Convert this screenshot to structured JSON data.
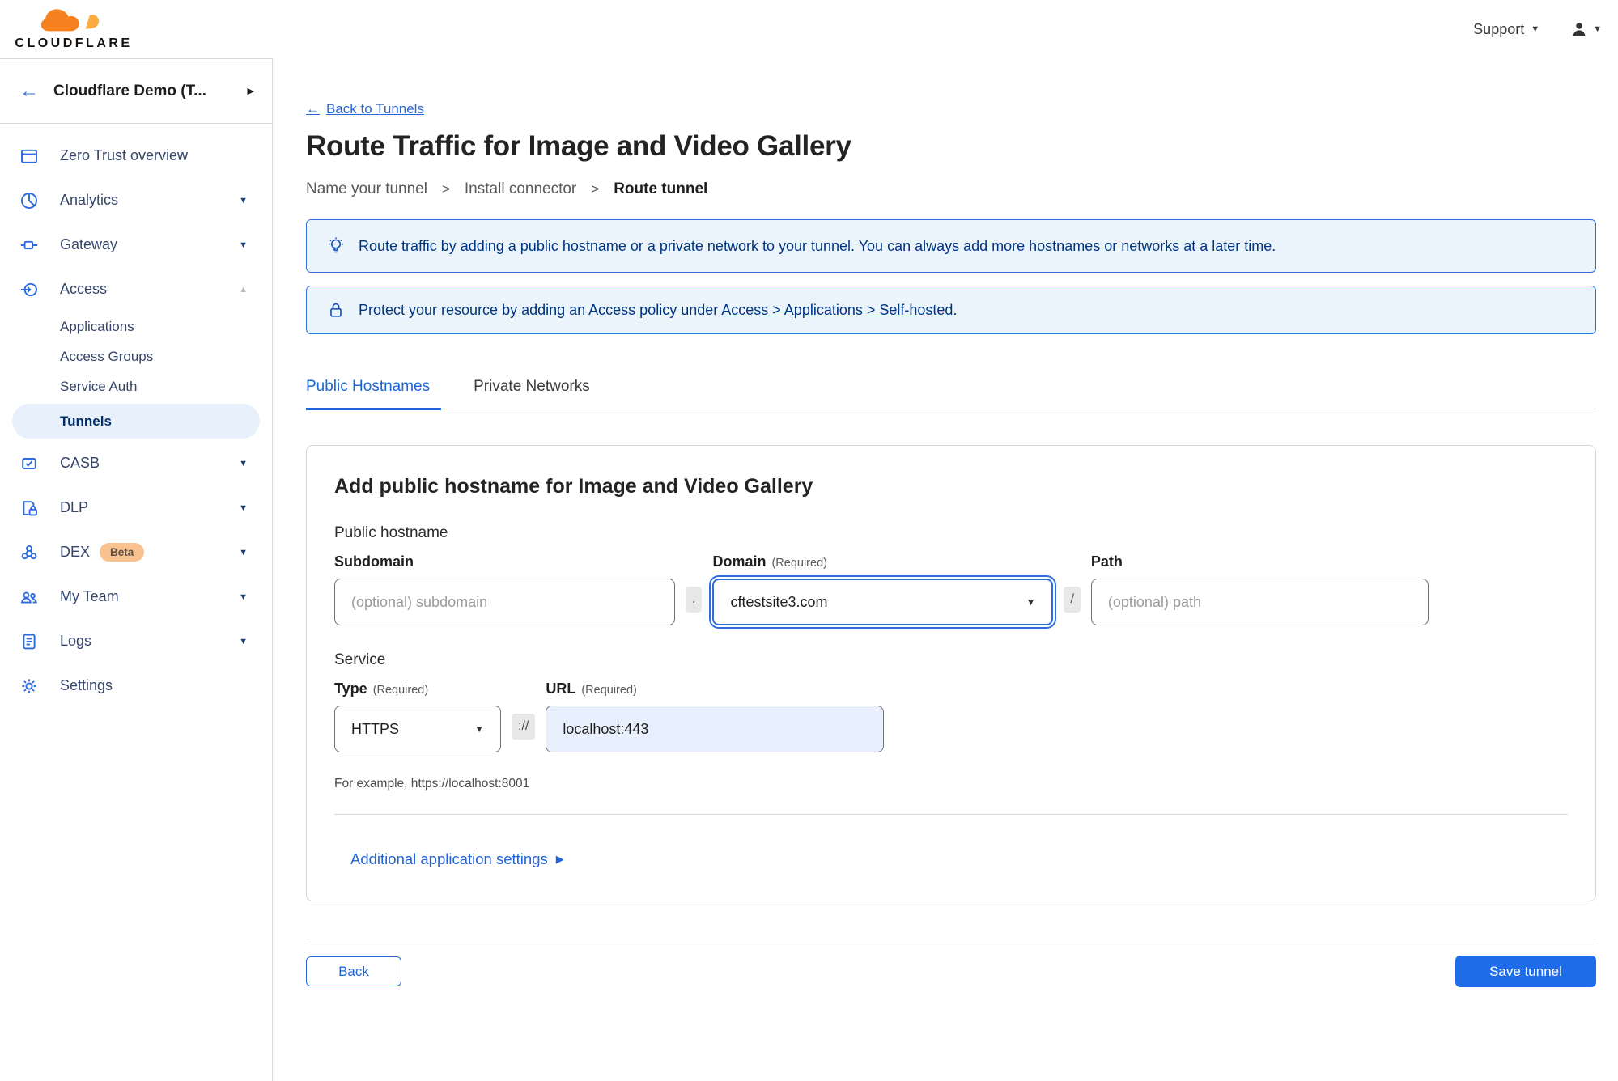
{
  "glyphs": {
    "back_arrow": "←",
    "expand_right": "▶",
    "chevron_down": "▼",
    "chevron_up": "▲",
    "caret_down": "▼",
    "breadcrumb_sep": ">",
    "disclosure_right": "▶"
  },
  "header": {
    "logo_word": "CLOUDFLARE",
    "support_label": "Support"
  },
  "sidebar": {
    "account_name": "Cloudflare Demo (T...",
    "items": [
      {
        "label": "Zero Trust overview",
        "chevron": false
      },
      {
        "label": "Analytics",
        "chevron": true
      },
      {
        "label": "Gateway",
        "chevron": true
      },
      {
        "label": "Access",
        "chevron": true
      },
      {
        "label": "CASB",
        "chevron": true
      },
      {
        "label": "DLP",
        "chevron": true
      },
      {
        "label": "DEX",
        "chevron": true,
        "badge": "Beta"
      },
      {
        "label": "My Team",
        "chevron": true
      },
      {
        "label": "Logs",
        "chevron": true
      },
      {
        "label": "Settings",
        "chevron": false
      }
    ],
    "access_children": [
      {
        "label": "Applications",
        "active": false
      },
      {
        "label": "Access Groups",
        "active": false
      },
      {
        "label": "Service Auth",
        "active": false
      },
      {
        "label": "Tunnels",
        "active": true
      }
    ]
  },
  "main": {
    "back_link": "Back to Tunnels",
    "title": "Route Traffic for Image and Video Gallery",
    "steps": {
      "step1": "Name your tunnel",
      "step2": "Install connector",
      "step3": "Route tunnel"
    },
    "banner_info": "Route traffic by adding a public hostname or a private network to your tunnel. You can always add more hostnames or networks at a later time.",
    "banner_protect": {
      "prefix": "Protect your resource by adding an Access policy under ",
      "link": "Access > Applications > Self-hosted",
      "suffix": "."
    },
    "tabs": {
      "public_hostnames": "Public Hostnames",
      "private_networks": "Private Networks"
    },
    "form": {
      "heading": "Add public hostname for Image and Video Gallery",
      "hostname_section": "Public hostname",
      "subdomain_label": "Subdomain",
      "subdomain_placeholder": "(optional) subdomain",
      "domain_label": "Domain",
      "domain_required": "(Required)",
      "domain_value": "cftestsite3.com",
      "path_label": "Path",
      "path_placeholder": "(optional) path",
      "sep_dot": ".",
      "sep_slash": "/",
      "sep_scheme": "://",
      "service_section": "Service",
      "type_label": "Type",
      "type_required": "(Required)",
      "type_value": "HTTPS",
      "url_label": "URL",
      "url_required": "(Required)",
      "url_value": "localhost:443",
      "example": "For example, https://localhost:8001",
      "additional_settings": "Additional application settings"
    },
    "footer": {
      "back": "Back",
      "save": "Save tunnel"
    }
  },
  "colors": {
    "accent_blue": "#1a66d9",
    "banner_navy": "#003681",
    "save_button": "#1f6ceb",
    "sidebar_icon": "#2e6bdf",
    "beta_badge_bg": "#f8c291"
  }
}
